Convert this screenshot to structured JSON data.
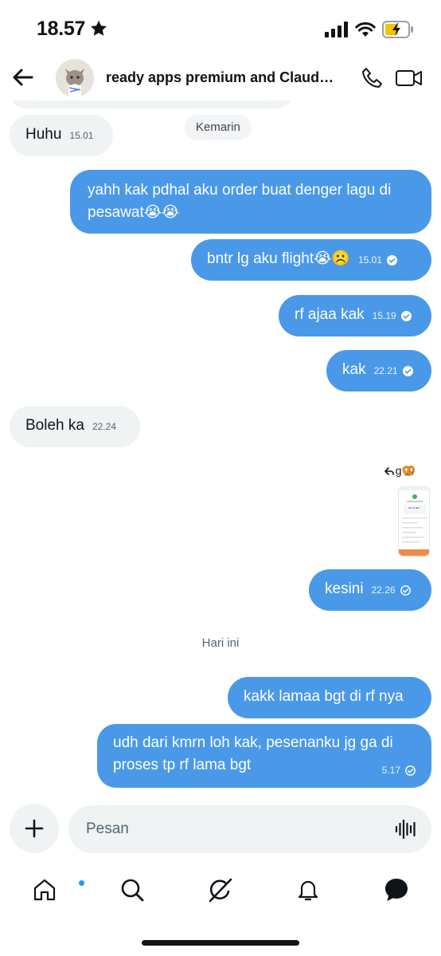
{
  "status_bar": {
    "time": "18.57"
  },
  "header": {
    "title": "ready apps premium and Claud…"
  },
  "days": {
    "yesterday": "Kemarin",
    "today": "Hari ini"
  },
  "messages": [
    {
      "text": "Huhu",
      "time": "15.01"
    },
    {
      "text": "yahh kak pdhal aku order buat denger lagu di pesawat😭😭"
    },
    {
      "text": "bntr lg aku flight😭☹️",
      "time": "15.01"
    },
    {
      "text": "rf ajaa kak",
      "time": "15.19"
    },
    {
      "text": "kak",
      "time": "22.21"
    },
    {
      "text": "Boleh ka",
      "time": "22.24"
    },
    {
      "text": "kesini",
      "time": "22.26"
    },
    {
      "text": "kakk lamaa bgt di rf nya"
    },
    {
      "text": "udh dari kmrn loh kak, pesenanku jg ga di proses tp rf lama bgt",
      "time": "5.17"
    }
  ],
  "reply_reference": {
    "text": "g🥨"
  },
  "screenshot_thumb": {
    "amount": "Rp 12.000"
  },
  "composer": {
    "placeholder": "Pesan"
  },
  "icons": {
    "status": [
      "star-icon",
      "signal-icon",
      "wifi-icon",
      "battery-charging-icon"
    ],
    "header": [
      "back-arrow-icon",
      "phone-icon",
      "video-icon"
    ],
    "composer": [
      "plus-icon",
      "voice-wave-icon"
    ],
    "tabs": [
      "home-icon",
      "search-icon",
      "grok-icon",
      "bell-icon",
      "messages-icon"
    ]
  },
  "colors": {
    "outgoing_bubble": "#4a99e9",
    "incoming_bubble": "#eff3f4",
    "accent": "#1d9bf0"
  }
}
